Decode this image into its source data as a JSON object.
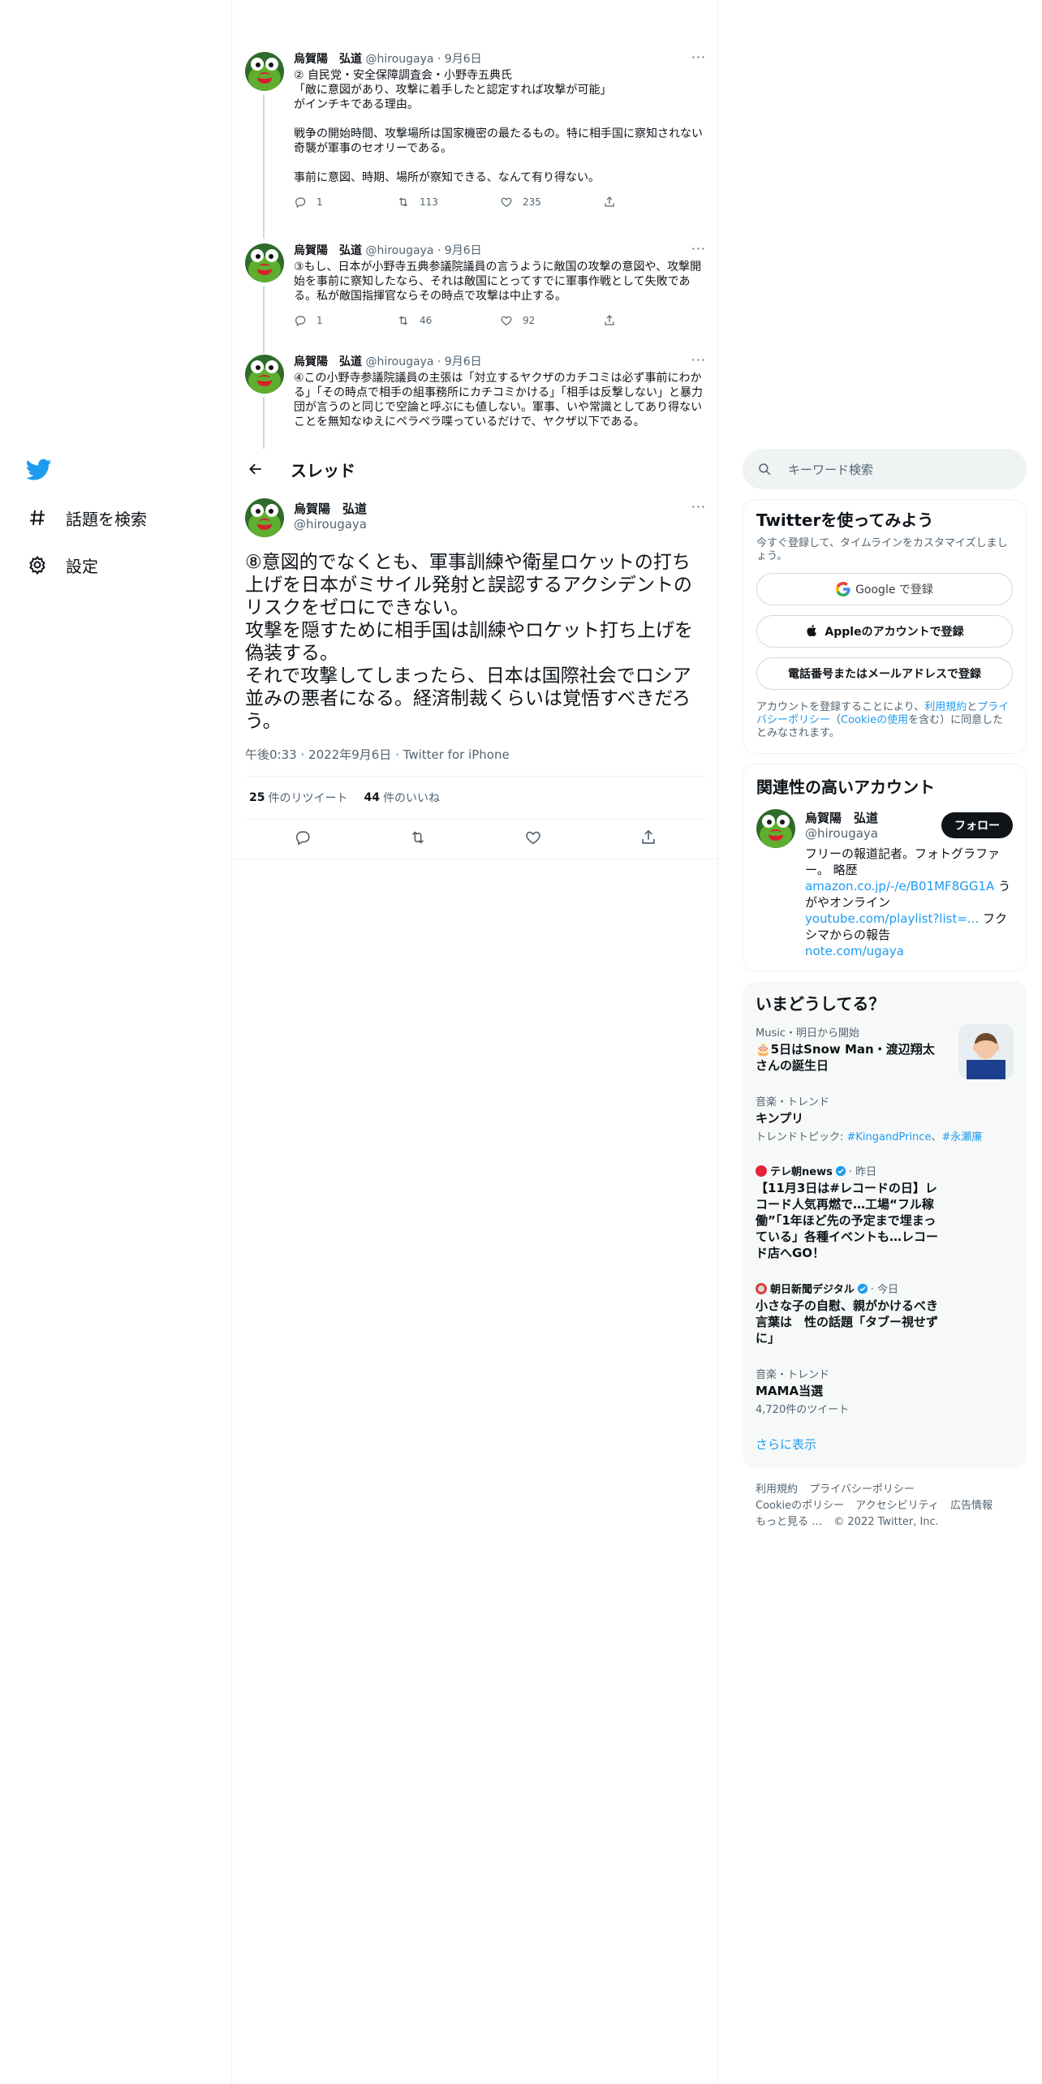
{
  "nav": {
    "explore_label": "話題を検索",
    "settings_label": "設定"
  },
  "thread_header": {
    "title": "スレッド"
  },
  "thread_tweets": [
    {
      "name": "烏賀陽　弘道",
      "handle": "@hirougaya",
      "dot": "·",
      "date": "9月6日",
      "text": "② 自民党・安全保障調査会・小野寺五典氏\n「敵に意図があり、攻撃に着手したと認定すれば攻撃が可能」\nがインチキである理由。\n\n戦争の開始時間、攻撃場所は国家機密の最たるもの。特に相手国に察知されない奇襲が軍事のセオリーである。\n\n事前に意図、時期、場所が察知できる、なんて有り得ない。",
      "replies": "1",
      "retweets": "113",
      "likes": "235"
    },
    {
      "name": "烏賀陽　弘道",
      "handle": "@hirougaya",
      "dot": "·",
      "date": "9月6日",
      "text": "③もし、日本が小野寺五典参議院議員の言うように敵国の攻撃の意図や、攻撃開始を事前に察知したなら、それは敵国にとってすでに軍事作戦として失敗である。私が敵国指揮官ならその時点で攻撃は中止する。",
      "replies": "1",
      "retweets": "46",
      "likes": "92"
    },
    {
      "name": "烏賀陽　弘道",
      "handle": "@hirougaya",
      "dot": "·",
      "date": "9月6日",
      "text": "④この小野寺参議院議員の主張は「対立するヤクザのカチコミは必ず事前にわかる」「その時点で相手の組事務所にカチコミかける」「相手は反撃しない」と暴力団が言うのと同じで空論と呼ぶにも値しない。軍事、いや常識としてあり得ないことを無知なゆえにペラペラ喋っているだけで、ヤクザ以下である。"
    }
  ],
  "focal_tweet": {
    "name": "烏賀陽　弘道",
    "handle": "@hirougaya",
    "text": "⑧意図的でなくとも、軍事訓練や衛星ロケットの打ち上げを日本がミサイル発射と誤認するアクシデントのリスクをゼロにできない。\n攻撃を隠すために相手国は訓練やロケット打ち上げを偽装する。\nそれで攻撃してしまったら、日本は国際社会でロシア並みの悪者になる。経済制裁くらいは覚悟すべきだろう。",
    "time": "午後0:33",
    "date": "2022年9月6日",
    "source": "Twitter for iPhone",
    "meta_sep": "·",
    "retweet_count": "25",
    "retweet_label": "件のリツイート",
    "like_count": "44",
    "like_label": "件のいいね"
  },
  "search": {
    "placeholder": "キーワード検索"
  },
  "signup": {
    "title": "Twitterを使ってみよう",
    "subtitle": "今すぐ登録して、タイムラインをカスタマイズしましょう。",
    "google_button": "Google で登録",
    "apple_button": "Appleのアカウントで登録",
    "phone_button": "電話番号またはメールアドレスで登録",
    "legal_prefix": "アカウントを登録することにより、",
    "legal_terms": "利用規約",
    "legal_and": "と",
    "legal_privacy": "プライバシーポリシー",
    "legal_open": "（",
    "legal_cookie": "Cookieの使用",
    "legal_suffix": "を含む）に同意したとみなされます。"
  },
  "related": {
    "title": "関連性の高いアカウント",
    "name": "烏賀陽　弘道",
    "handle": "@hirougaya",
    "follow_label": "フォロー",
    "bio_text": "フリーの報道記者。フォトグラファー。 略歴",
    "bio_link1": "amazon.co.jp/-/e/B01MF8GG1A",
    "bio_mid": "うがやオンライン",
    "bio_link2": "youtube.com/playlist?list=...",
    "bio_mid2": "フクシマからの報告",
    "bio_link3": "note.com/ugaya"
  },
  "trends": {
    "title": "いまどうしてる？",
    "items": [
      {
        "context": "Music・明日から開始",
        "title": "🎂5日はSnow Man・渡辺翔太さんの誕生日"
      },
      {
        "context": "音楽・トレンド",
        "title": "キンプリ",
        "meta_prefix": "トレンドトピック: ",
        "meta_tag1": "#KingandPrince",
        "meta_sep": "、",
        "meta_tag2": "#永瀬廉"
      },
      {
        "source": "テレ朝news",
        "since": "· 昨日",
        "title": "【11月3日は#レコードの日】レコード人気再燃で…工場“フル稼働”「1年ほど先の予定まで埋まっている」各種イベントも…レコード店へGO！"
      },
      {
        "source": "朝日新聞デジタル",
        "since": "· 今日",
        "title": "小さな子の自慰、親がかけるべき言葉は　性の話題「タブー視せずに」"
      },
      {
        "context": "音楽・トレンド",
        "title": "MAMA当選",
        "meta": "4,720件のツイート"
      }
    ],
    "show_more": "さらに表示"
  },
  "footer": {
    "terms": "利用規約",
    "privacy": "プライバシーポリシー",
    "cookie": "Cookieのポリシー",
    "accessibility": "アクセシビリティ",
    "ads": "広告情報",
    "more": "もっと見る …",
    "copyright": "© 2022 Twitter, Inc."
  },
  "colors": {
    "accent": "#1d9bf0",
    "text": "#0f1419",
    "muted": "#536471",
    "border": "#eff3f4",
    "like": "#f91880"
  },
  "icons": [
    "twitter-logo-icon",
    "hashtag-icon",
    "gear-icon",
    "back-arrow-icon",
    "reply-icon",
    "retweet-icon",
    "like-icon",
    "share-icon",
    "more-icon",
    "search-icon",
    "google-icon",
    "apple-icon",
    "verified-icon"
  ]
}
